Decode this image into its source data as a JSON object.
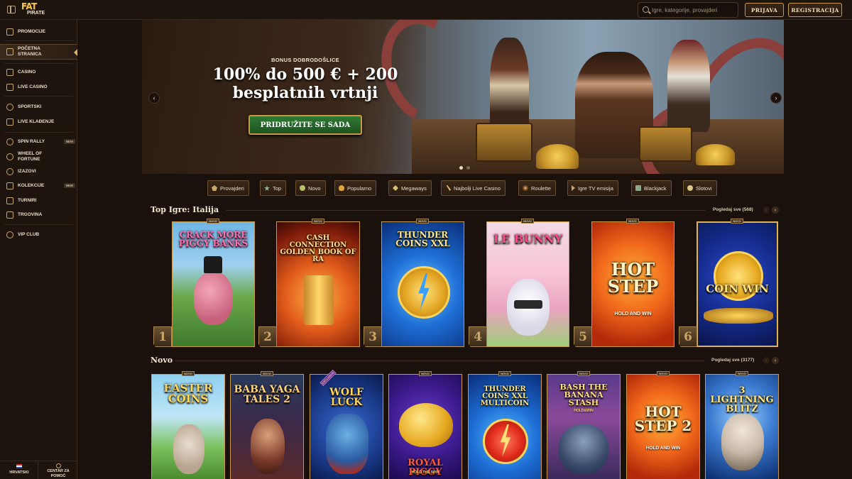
{
  "header": {
    "logo_top": "FAT",
    "logo_bottom": "PIRATE",
    "search_placeholder": "Igre, kategorije, provajderi",
    "login_label": "PRIJAVA",
    "register_label": "REGISTRACIJA"
  },
  "sidebar": {
    "items": [
      {
        "label": "PROMOCIJE",
        "icon": "gift-icon"
      },
      {
        "label": "POČETNA STRANICA",
        "icon": "home-icon",
        "active": true
      },
      {
        "label": "CASINO",
        "icon": "slot-icon"
      },
      {
        "label": "LIVE CASINO",
        "icon": "cards-icon"
      },
      {
        "label": "SPORTSKI",
        "icon": "ball-icon"
      },
      {
        "label": "LIVE KLAĐENJE",
        "icon": "live-bet-icon"
      },
      {
        "label": "SPIN RALLY",
        "icon": "rally-icon",
        "badge": "NEW"
      },
      {
        "label": "WHEEL OF FORTUNE",
        "icon": "wheel-icon"
      },
      {
        "label": "IZAZOVI",
        "icon": "challenge-icon"
      },
      {
        "label": "KOLEKCIJE",
        "icon": "collection-icon",
        "badge": "NEW"
      },
      {
        "label": "TURNIRI",
        "icon": "trophy-icon"
      },
      {
        "label": "TRGOVINA",
        "icon": "shop-icon"
      },
      {
        "label": "VIP CLUB",
        "icon": "crown-icon"
      }
    ],
    "language": "HRVATSKI",
    "help": "CENTAR ZA POMOĆ"
  },
  "hero": {
    "subtitle": "BONUS DOBRODOŠLICE",
    "title_line1": "100% do 500 € + 200",
    "title_line2": "besplatnih vrtnji",
    "cta": "PRIDRUŽITE SE SADA",
    "slide_index": 1,
    "slide_count": 2
  },
  "categories": [
    {
      "label": "Provajderi",
      "icon": "provider-icon"
    },
    {
      "label": "Top",
      "icon": "star-icon"
    },
    {
      "label": "Novo",
      "icon": "new-icon"
    },
    {
      "label": "Popularno",
      "icon": "fire-icon"
    },
    {
      "label": "Megaways",
      "icon": "megaways-icon"
    },
    {
      "label": "Najbolji Live Casino",
      "icon": "live-casino-icon"
    },
    {
      "label": "Roulette",
      "icon": "roulette-icon"
    },
    {
      "label": "Igre TV emisija",
      "icon": "tv-icon"
    },
    {
      "label": "Blackjack",
      "icon": "blackjack-icon"
    },
    {
      "label": "Slotovi",
      "icon": "slots-icon"
    }
  ],
  "top_games": {
    "title": "Top Igre: Italija",
    "see_all": "Pogledaj sve (568)",
    "games": [
      {
        "rank": "1",
        "badge": "NOVO",
        "title": "CRACK MORE PIGGY BANKS"
      },
      {
        "rank": "2",
        "badge": "NOVO",
        "title": "CASH CONNECTION GOLDEN BOOK OF RA"
      },
      {
        "rank": "3",
        "badge": "NOVO",
        "title": "THUNDER COINS XXL"
      },
      {
        "rank": "4",
        "badge": "NOVO",
        "title": "LE BUNNY"
      },
      {
        "rank": "5",
        "badge": "NOVO",
        "title": "HOT STEP",
        "subtitle": "HOLD AND WIN"
      },
      {
        "rank": "6",
        "badge": "NOVO",
        "title": "COIN WIN"
      }
    ]
  },
  "new_games": {
    "title": "Novo",
    "see_all": "Pogledaj sve (3177)",
    "games": [
      {
        "badge": "NOVO",
        "title": "EASTER COINS"
      },
      {
        "badge": "NOVO",
        "title": "BABA YAGA TALES 2"
      },
      {
        "badge": "EXCLUSIVE",
        "title": "WOLF LUCK"
      },
      {
        "badge": "NOVO",
        "title": "ROYAL PIGGY",
        "subtitle": "HOLD THE SPIN"
      },
      {
        "badge": "NOVO",
        "title": "THUNDER COINS XXL MULTICOIN"
      },
      {
        "badge": "NOVO",
        "title": "BASH THE BANANA STASH",
        "subtitle": "HOLD&WIN"
      },
      {
        "badge": "NOVO",
        "title": "HOT STEP 2",
        "subtitle": "HOLD AND WIN"
      },
      {
        "badge": "NOVO",
        "title": "3 LIGHTNING BLITZ"
      }
    ]
  },
  "colors": {
    "background": "#1a110c",
    "sidebar": "#1d140e",
    "accent_gold": "#c99a45",
    "cta_green": "#2f7a34"
  }
}
